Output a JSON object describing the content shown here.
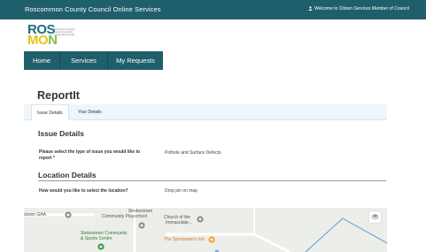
{
  "header": {
    "site_title": "Roscommon County Council Online Services",
    "welcome": "Welcome to Citizen Services Member of Council"
  },
  "logo": {
    "letters_top": "ROS",
    "letters_bottom": [
      "M",
      "O",
      "N"
    ],
    "tagline": "Roscommon County Council Comhairle Contae Ros Comáin"
  },
  "nav": {
    "items": [
      {
        "label": "Home"
      },
      {
        "label": "Services"
      },
      {
        "label": "My Requests"
      }
    ]
  },
  "page": {
    "title": "ReportIt"
  },
  "tabs": [
    {
      "label": "Issue Details",
      "active": true
    },
    {
      "label": "Your Details",
      "active": false
    }
  ],
  "issue_details": {
    "heading": "Issue Details",
    "question_line1": "Please select the type of issue you would like to",
    "question_line2": "report *",
    "answer": "Pothole and Surface Defects"
  },
  "location_details": {
    "heading": "Location Details",
    "question": "How would you like to select the location?",
    "answer": "Drop pin on map"
  },
  "map": {
    "labels": {
      "gaa": "stown GAA",
      "playschool_1": "Strokestown",
      "playschool_2": "Community Playschool",
      "church_1": "Church of the",
      "church_2": "Immaculate...",
      "community_1": "Stokestown Community",
      "community_2": "& Sports Centre",
      "inn": "The Sportsman's Inn"
    },
    "colors": {
      "road": "#ffffff",
      "route": "#7aa6e0",
      "pin_gray": "#8c8f94",
      "pin_orange": "#f2a33a",
      "pin_green": "#3d9a52"
    }
  },
  "colors": {
    "brand": "#1f5f6b",
    "tab_bg": "#eef6fb"
  }
}
